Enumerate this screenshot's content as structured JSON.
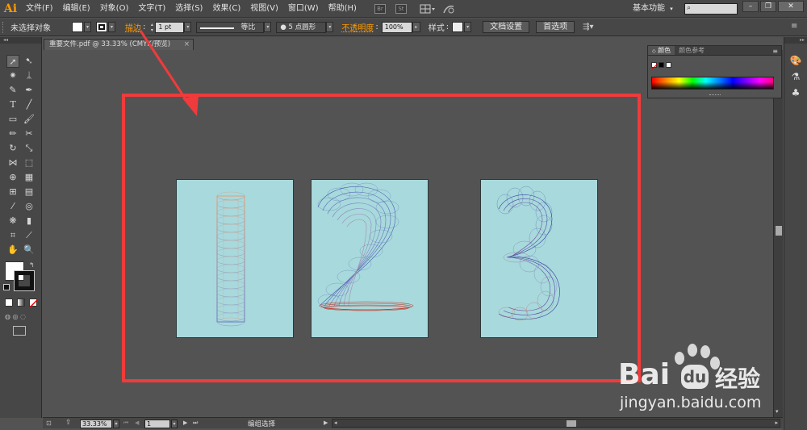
{
  "app": {
    "logo": "Ai",
    "menu": [
      "文件(F)",
      "编辑(E)",
      "对象(O)",
      "文字(T)",
      "选择(S)",
      "效果(C)",
      "视图(V)",
      "窗口(W)",
      "帮助(H)"
    ],
    "menubar_icons": [
      "Br",
      "St"
    ],
    "workspace": "基本功能",
    "search_placeholder": ""
  },
  "control_bar": {
    "selection_status": "未选择对象",
    "stroke_label": "描边",
    "stroke_weight": "1 pt",
    "stroke_profile": "等比",
    "brush": "5 点圆形",
    "opacity_label": "不透明度",
    "opacity_value": "100%",
    "style_label": "样式",
    "doc_setup_button": "文档设置",
    "preferences_button": "首选项"
  },
  "document": {
    "tab_title": "重要文件.pdf @ 33.33% (CMYK/预览)",
    "close_glyph": "×"
  },
  "color_panel": {
    "tabs": [
      "颜色",
      "颜色参考"
    ]
  },
  "status_bar": {
    "zoom": "33.33%",
    "artboard_number": "1",
    "status_text": "编组选择"
  },
  "artboards": [
    {
      "glyph": "1",
      "colors": [
        "#e0a080",
        "#7070c0"
      ]
    },
    {
      "glyph": "2",
      "colors": [
        "#4a5cb0",
        "#c04030"
      ]
    },
    {
      "glyph": "3",
      "colors": [
        "#3040a0",
        "#d04030"
      ]
    }
  ],
  "watermark": {
    "brand": "Bai",
    "brand_cn": "经验",
    "url": "jingyan.baidu.com"
  },
  "colors": {
    "accent_orange": "#ff9a00",
    "highlight_red": "#ef3b3b",
    "artboard_fill": "#a8d9dc"
  }
}
